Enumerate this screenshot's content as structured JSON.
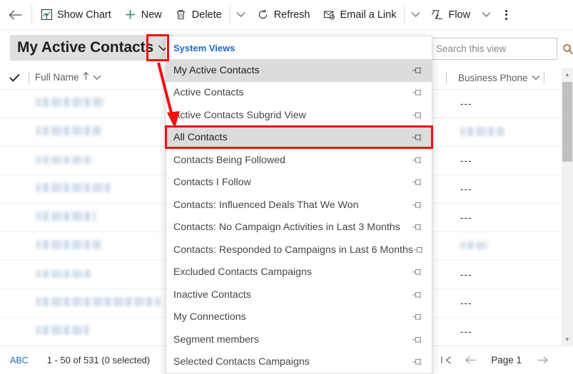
{
  "commandbar": {
    "back_label": "Back",
    "buttons": [
      {
        "label": "Show Chart",
        "icon": "chart-icon"
      },
      {
        "label": "New",
        "icon": "plus-icon"
      },
      {
        "label": "Delete",
        "icon": "trash-icon"
      },
      {
        "label": "Refresh",
        "icon": "refresh-icon"
      },
      {
        "label": "Email a Link",
        "icon": "email-icon"
      },
      {
        "label": "Flow",
        "icon": "flow-icon"
      }
    ],
    "overflow_label": "More commands"
  },
  "view": {
    "title": "My Active Contacts",
    "chevron_icon": "chevron-down-icon"
  },
  "search": {
    "placeholder": "Search this view",
    "value": "",
    "icon": "search-icon"
  },
  "grid": {
    "select_all_icon": "checkmark-icon",
    "columns": [
      {
        "label": "Full Name",
        "sort": "ascending",
        "sort_icon": "arrow-up-icon"
      },
      {
        "label": "Business Phone",
        "sort": "none"
      }
    ],
    "rows": [
      {
        "name_redacted": true,
        "name_width": 96,
        "phone": "---"
      },
      {
        "name_redacted": true,
        "name_width": 92,
        "phone": ""
      },
      {
        "name_redacted": true,
        "name_width": 80,
        "phone": "---"
      },
      {
        "name_redacted": true,
        "name_width": 104,
        "phone": "---"
      },
      {
        "name_redacted": true,
        "name_width": 84,
        "phone": "---"
      },
      {
        "name_redacted": true,
        "name_width": 92,
        "phone": ""
      },
      {
        "name_redacted": true,
        "name_width": 81,
        "phone": "---"
      },
      {
        "name_redacted": true,
        "name_width": 175,
        "phone": "---"
      },
      {
        "name_redacted": true,
        "name_width": 74,
        "phone": "---"
      },
      {
        "name_redacted": true,
        "name_width": 60,
        "phone": "---"
      }
    ]
  },
  "dropdown": {
    "section_header": "System Views",
    "items": [
      {
        "label": "My Active Contacts",
        "selected": true,
        "highlighted": false,
        "pin_icon": "pin-icon"
      },
      {
        "label": "Active Contacts",
        "selected": false,
        "highlighted": false,
        "pin_icon": "pin-icon"
      },
      {
        "label": "Active Contacts Subgrid View",
        "selected": false,
        "highlighted": false,
        "pin_icon": "pin-icon"
      },
      {
        "label": "All Contacts",
        "selected": false,
        "highlighted": true,
        "pin_icon": "pin-icon"
      },
      {
        "label": "Contacts Being Followed",
        "selected": false,
        "highlighted": false,
        "pin_icon": "pin-icon"
      },
      {
        "label": "Contacts I Follow",
        "selected": false,
        "highlighted": false,
        "pin_icon": "pin-icon"
      },
      {
        "label": "Contacts: Influenced Deals That We Won",
        "selected": false,
        "highlighted": false,
        "pin_icon": "pin-icon"
      },
      {
        "label": "Contacts: No Campaign Activities in Last 3 Months",
        "selected": false,
        "highlighted": false,
        "pin_icon": "pin-icon"
      },
      {
        "label": "Contacts: Responded to Campaigns in Last 6 Months",
        "selected": false,
        "highlighted": false,
        "pin_icon": "pin-icon"
      },
      {
        "label": "Excluded Contacts Campaigns",
        "selected": false,
        "highlighted": false,
        "pin_icon": "pin-icon"
      },
      {
        "label": "Inactive Contacts",
        "selected": false,
        "highlighted": false,
        "pin_icon": "pin-icon"
      },
      {
        "label": "My Connections",
        "selected": false,
        "highlighted": false,
        "pin_icon": "pin-icon"
      },
      {
        "label": "Segment members",
        "selected": false,
        "highlighted": false,
        "pin_icon": "pin-icon"
      },
      {
        "label": "Selected Contacts Campaigns",
        "selected": false,
        "highlighted": false,
        "pin_icon": "pin-icon"
      }
    ]
  },
  "footer": {
    "alpha_index": "ABC",
    "record_count": "1 - 50 of 531 (0 selected)",
    "page_label": "Page 1",
    "first_page_icon": "first-page-icon",
    "prev_page_icon": "previous-page-icon",
    "next_page_icon": "next-page-icon"
  },
  "annotations": {
    "accent_color": "#ee1111",
    "chevron_box": "highlight-view-chevron",
    "item_box": "highlight-all-contacts",
    "arrow": "arrow-pointing-to-all-contacts"
  },
  "colors": {
    "link": "#2266cc",
    "selected_bg": "#dedcda",
    "title_bg": "#e1dfdd",
    "accent_red": "#ee1111"
  }
}
